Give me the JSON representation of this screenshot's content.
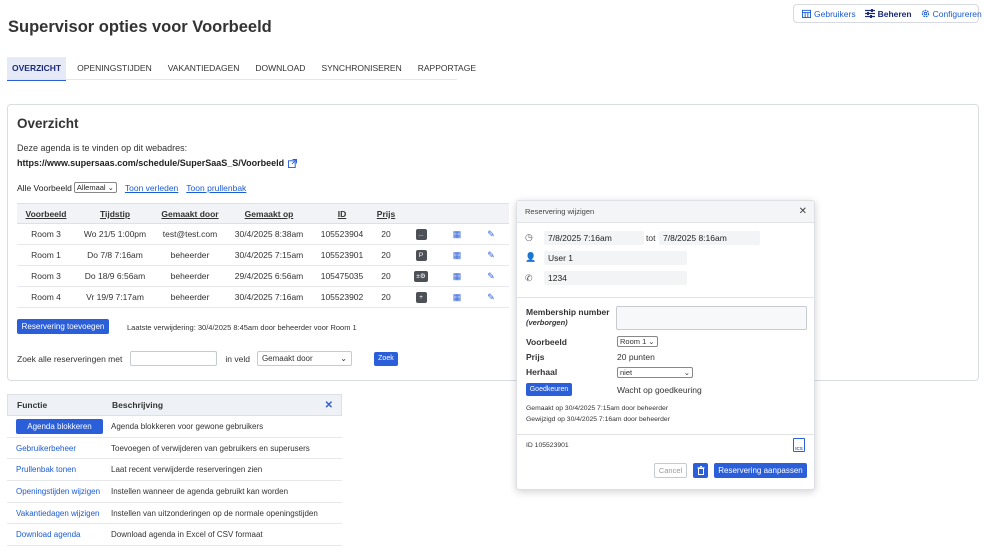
{
  "header": {
    "title": "Supervisor opties voor Voorbeeld"
  },
  "topnav": [
    {
      "label": "Gebruikers",
      "icon": "calendar-grid-icon",
      "active": false
    },
    {
      "label": "Beheren",
      "icon": "sliders-icon",
      "active": true
    },
    {
      "label": "Configureren",
      "icon": "gear-icon",
      "active": false
    }
  ],
  "tabs": [
    "OVERZICHT",
    "OPENINGSTIJDEN",
    "VAKANTIEDAGEN",
    "DOWNLOAD",
    "SYNCHRONISEREN",
    "RAPPORTAGE"
  ],
  "overview": {
    "title": "Overzicht",
    "intro": "Deze agenda is te vinden op dit webadres:",
    "url": "https://www.supersaas.com/schedule/SuperSaaS_S/Voorbeeld",
    "filter_label": "Alle Voorbeeld",
    "filter_value": "Allemaal",
    "link_past": "Toon verleden",
    "link_trash": "Toon prullenbak",
    "columns": [
      "Voorbeeld",
      "Tijdstip",
      "Gemaakt door",
      "Gemaakt op",
      "ID",
      "Prijs"
    ],
    "rows": [
      {
        "resource": "Room 3",
        "time": "Wo 21/5 1:00pm",
        "by": "test@test.com",
        "on": "30/4/2025 8:38am",
        "id": "105523904",
        "price": "20",
        "badge": "..."
      },
      {
        "resource": "Room 1",
        "time": "Do 7/8 7:16am",
        "by": "beheerder",
        "on": "30/4/2025 7:15am",
        "id": "105523901",
        "price": "20",
        "badge": "P"
      },
      {
        "resource": "Room 3",
        "time": "Do 18/9 6:56am",
        "by": "beheerder",
        "on": "29/4/2025 6:56am",
        "id": "105475035",
        "price": "20",
        "badge": "±⚙"
      },
      {
        "resource": "Room 4",
        "time": "Vr 19/9 7:17am",
        "by": "beheerder",
        "on": "30/4/2025 7:16am",
        "id": "105523902",
        "price": "20",
        "badge": "+"
      }
    ],
    "add_button": "Reservering toevoegen",
    "last_deleted": "Laatste verwijdering: 30/4/2025 8:45am door beheerder voor Room 1",
    "search_label": "Zoek alle reserveringen met",
    "search_field_label": "in veld",
    "search_field_value": "Gemaakt door",
    "search_button": "Zoek"
  },
  "functions": {
    "col1": "Functie",
    "col2": "Beschrijving",
    "rows": [
      {
        "name": "Agenda blokkeren",
        "desc": "Agenda blokkeren voor gewone gebruikers",
        "button": true
      },
      {
        "name": "Gebruikerbeheer",
        "desc": "Toevoegen of verwijderen van gebruikers en superusers"
      },
      {
        "name": "Prullenbak tonen",
        "desc": "Laat recent verwijderde reserveringen zien"
      },
      {
        "name": "Openingstijden wijzigen",
        "desc": "Instellen wanneer de agenda gebruikt kan worden"
      },
      {
        "name": "Vakantiedagen wijzigen",
        "desc": "Instellen van uitzonderingen op de normale openingstijden"
      },
      {
        "name": "Download agenda",
        "desc": "Download agenda in Excel of CSV formaat"
      }
    ]
  },
  "modal": {
    "title": "Reservering wijzigen",
    "start": "7/8/2025 7:16am",
    "to_label": "tot",
    "end": "7/8/2025 8:16am",
    "user": "User 1",
    "phone": "1234",
    "membership_label": "Membership number",
    "membership_sub": "(verborgen)",
    "resource_label": "Voorbeeld",
    "resource_value": "Room 1",
    "price_label": "Prijs",
    "price_value": "20 punten",
    "repeat_label": "Herhaal",
    "repeat_value": "niet",
    "approve_button": "Goedkeuren",
    "approve_status": "Wacht op goedkeuring",
    "created": "Gemaakt op 30/4/2025 7:15am door beheerder",
    "modified": "Gewijzigd op 30/4/2025 7:16am door beheerder",
    "id_text": "ID 105523901",
    "ics_label": "ICS",
    "cancel_button": "Cancel",
    "save_button": "Reservering aanpassen"
  }
}
